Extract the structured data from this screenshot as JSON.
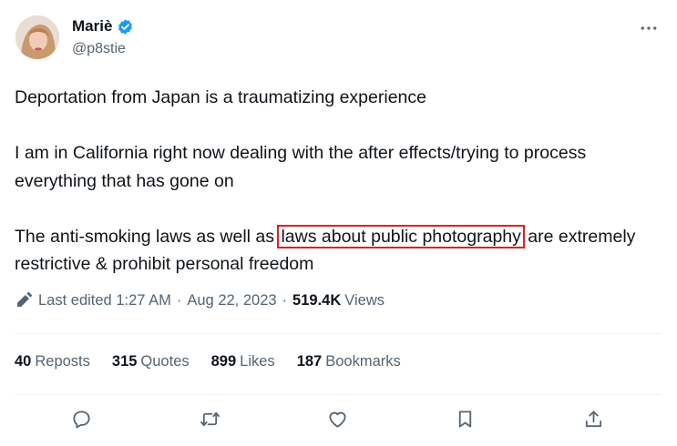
{
  "author": {
    "name": "Mariè",
    "handle": "@p8stie",
    "verified_color": "#1d9bf0"
  },
  "tweet": {
    "para1": "Deportation from Japan is a traumatizing experience",
    "para2": "I am in California right now dealing with the after effects/trying to process everything that has gone on",
    "para3_before": "The anti-smoking laws as well as ",
    "para3_highlight": "laws about public photography",
    "para3_after": " are extremely restrictive & prohibit personal freedom",
    "highlight_color": "#e0201e"
  },
  "meta": {
    "edited_label": "Last edited",
    "time": "1:27 AM",
    "separator": "·",
    "date": "Aug 22, 2023",
    "views_count": "519.4K",
    "views_label": "Views"
  },
  "stats": {
    "reposts_count": "40",
    "reposts_label": "Reposts",
    "quotes_count": "315",
    "quotes_label": "Quotes",
    "likes_count": "899",
    "likes_label": "Likes",
    "bookmarks_count": "187",
    "bookmarks_label": "Bookmarks"
  },
  "icons": {
    "more": "more-horizontal-icon",
    "reply": "reply-icon",
    "repost": "repost-icon",
    "like": "heart-icon",
    "bookmark": "bookmark-icon",
    "share": "share-icon"
  }
}
